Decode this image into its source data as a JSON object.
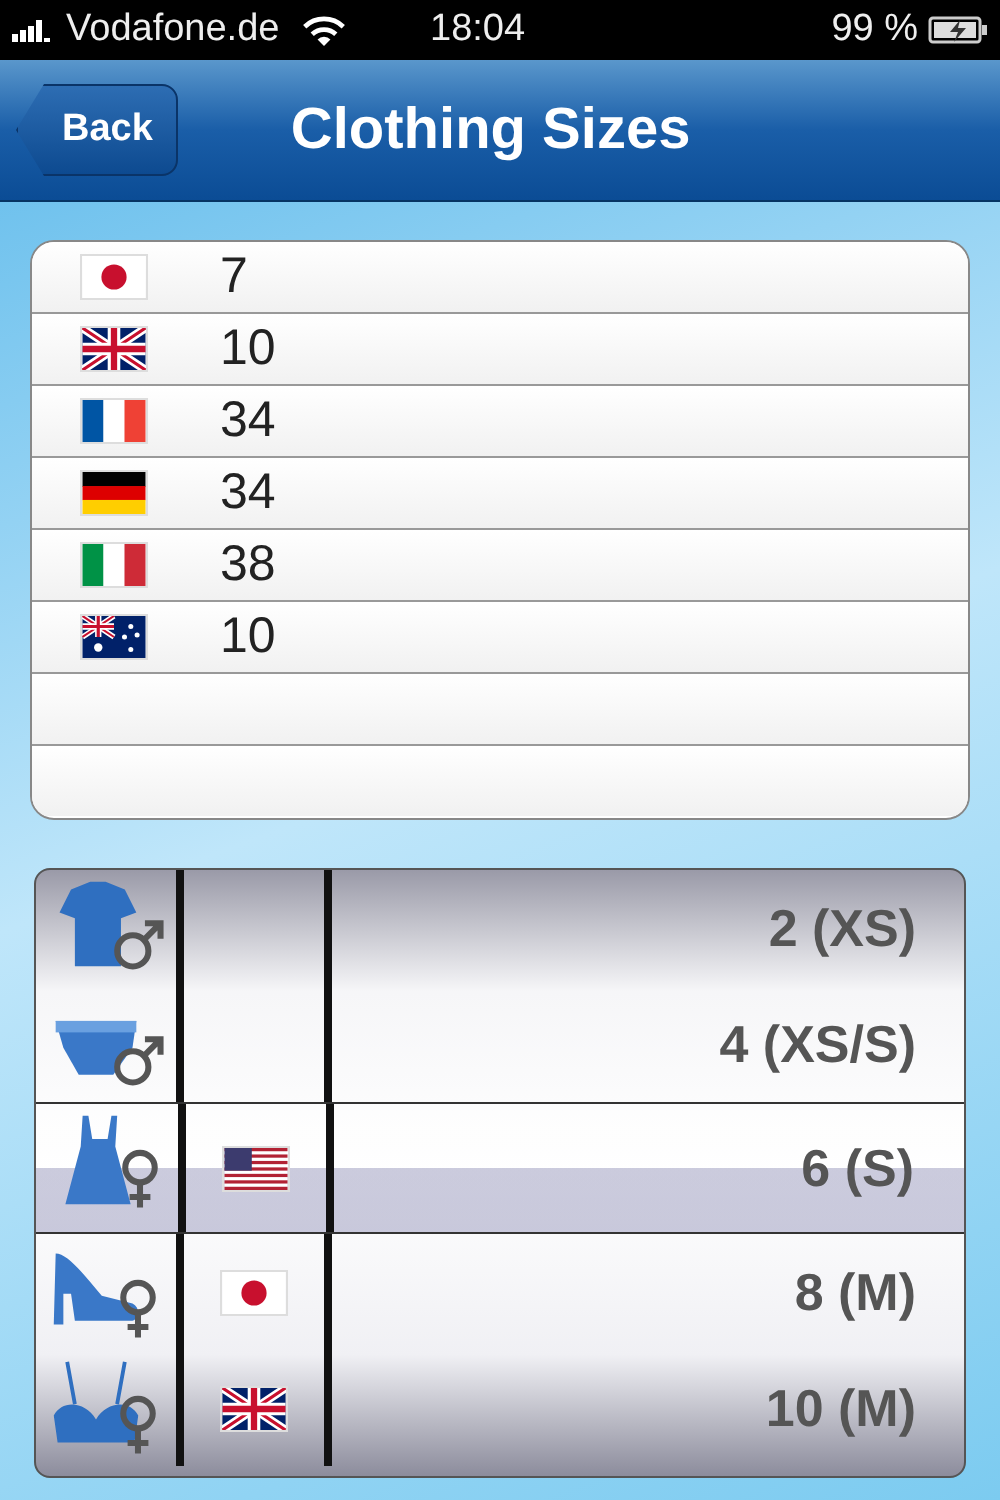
{
  "status_bar": {
    "carrier": "Vodafone.de",
    "time": "18:04",
    "battery": "99 %"
  },
  "nav_bar": {
    "back": "Back",
    "title": "Clothing Sizes"
  },
  "sizes": [
    {
      "flag": {
        "kind": "jp"
      },
      "size": "7"
    },
    {
      "flag": {
        "kind": "gb"
      },
      "size": "10"
    },
    {
      "flag": {
        "kind": "fr"
      },
      "size": "34"
    },
    {
      "flag": {
        "kind": "de"
      },
      "size": "34"
    },
    {
      "flag": {
        "kind": "it"
      },
      "size": "38"
    },
    {
      "flag": {
        "kind": "au"
      },
      "size": "10"
    }
  ],
  "picker": [
    {
      "garment": {
        "kind": "shirt"
      },
      "gender": {
        "kind": "male"
      },
      "size": "2 (XS)",
      "selected": false
    },
    {
      "garment": {
        "kind": "briefs"
      },
      "gender": {
        "kind": "male"
      },
      "size": "4 (XS/S)",
      "selected": false
    },
    {
      "garment": {
        "kind": "dress"
      },
      "gender": {
        "kind": "female"
      },
      "flag": {
        "kind": "us"
      },
      "size": "6 (S)",
      "selected": true
    },
    {
      "garment": {
        "kind": "shoe"
      },
      "gender": {
        "kind": "female"
      },
      "flag": {
        "kind": "jp"
      },
      "size": "8 (M)",
      "selected": false
    },
    {
      "garment": {
        "kind": "bra"
      },
      "gender": {
        "kind": "female"
      },
      "flag": {
        "kind": "gb"
      },
      "size": "10 (M)",
      "selected": false
    }
  ]
}
